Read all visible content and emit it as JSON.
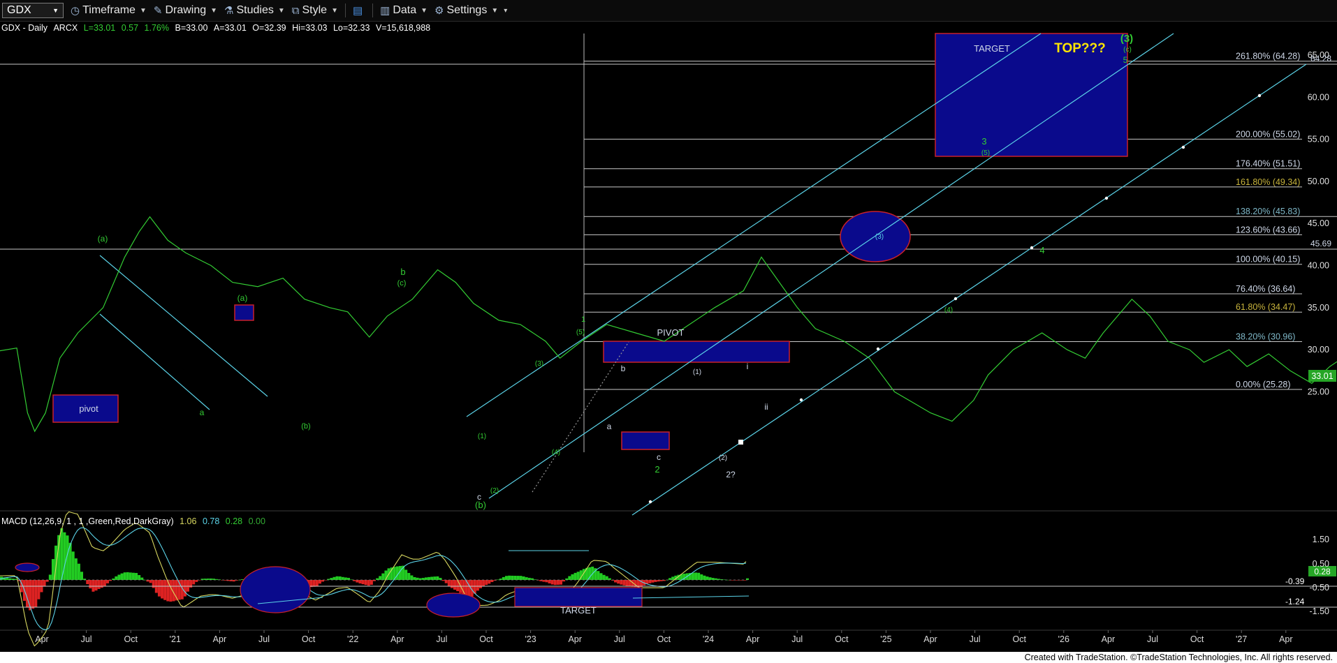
{
  "toolbar": {
    "symbol": "GDX",
    "timeframe_label": "Timeframe",
    "drawing_label": "Drawing",
    "studies_label": "Studies",
    "style_label": "Style",
    "data_label": "Data",
    "settings_label": "Settings"
  },
  "header": {
    "title": "GDX - Daily",
    "exchange": "ARCX",
    "last": "L=33.01",
    "change": "0.57",
    "change_pct": "1.76%",
    "bid": "B=33.00",
    "ask": "A=33.01",
    "open": "O=32.39",
    "high": "Hi=33.03",
    "low": "Lo=32.33",
    "volume": "V=15,618,988"
  },
  "macd": {
    "title": "MACD (12,26,9, 1 , 1 ,Green,Red,DarkGray)",
    "v1": "1.06",
    "v2": "0.78",
    "v3": "0.28",
    "v4": "0.00",
    "y_ticks": [
      "1.50",
      "0.50",
      "-0.50",
      "-1.50"
    ],
    "markers": [
      "-0.39",
      "-1.24"
    ],
    "current": "0.28"
  },
  "footer": {
    "text": "Created with TradeStation. ©TradeStation Technologies, Inc. All rights reserved."
  },
  "colors": {
    "price": "#33cc33",
    "fib_line": "#c8c8c8",
    "channel": "#5bd3e8",
    "box_fill": "#0a0a8c",
    "box_border": "#c8202a",
    "label_green": "#33cc33",
    "label_cyan": "#5bd3e8",
    "fib_label_default": "#cfd8e8",
    "fib_label_gold": "#c8b43c",
    "fib_label_teal": "#7fb8c8",
    "top_text": "#ffe600",
    "price_tag": "#26a626"
  },
  "chart_data": {
    "type": "line",
    "symbol": "GDX",
    "interval": "Daily",
    "y_axis": {
      "min": 20,
      "max": 67,
      "ticks": [
        25,
        30,
        35,
        40,
        45,
        50,
        55,
        60,
        65
      ]
    },
    "x_axis_labels": [
      "Apr",
      "Jul",
      "Oct",
      "'21",
      "Apr",
      "Jul",
      "Oct",
      "'22",
      "Apr",
      "Jul",
      "Oct",
      "'23",
      "Apr",
      "Jul",
      "Oct",
      "'24",
      "Apr",
      "Jul",
      "Oct",
      "'25",
      "Apr",
      "Jul",
      "Oct",
      "'26",
      "Apr",
      "Jul",
      "Oct",
      "'27",
      "Apr"
    ],
    "last_price": "33.01",
    "price_points": [
      [
        2020.0,
        29
      ],
      [
        2020.08,
        29.5
      ],
      [
        2020.18,
        30.2
      ],
      [
        2020.21,
        22.5
      ],
      [
        2020.23,
        20.3
      ],
      [
        2020.26,
        22.5
      ],
      [
        2020.3,
        29
      ],
      [
        2020.35,
        32
      ],
      [
        2020.42,
        35
      ],
      [
        2020.48,
        41
      ],
      [
        2020.52,
        44
      ],
      [
        2020.55,
        45.8
      ],
      [
        2020.6,
        43
      ],
      [
        2020.65,
        41.5
      ],
      [
        2020.72,
        40
      ],
      [
        2020.78,
        38
      ],
      [
        2020.85,
        37.5
      ],
      [
        2020.92,
        38.5
      ],
      [
        2020.98,
        36
      ],
      [
        2021.05,
        35
      ],
      [
        2021.1,
        34.5
      ],
      [
        2021.16,
        31.5
      ],
      [
        2021.21,
        34
      ],
      [
        2021.28,
        36
      ],
      [
        2021.35,
        39.5
      ],
      [
        2021.4,
        38
      ],
      [
        2021.45,
        35.5
      ],
      [
        2021.52,
        33.5
      ],
      [
        2021.58,
        33
      ],
      [
        2021.65,
        31
      ],
      [
        2021.69,
        29
      ],
      [
        2021.75,
        31
      ],
      [
        2021.82,
        33
      ],
      [
        2021.9,
        32
      ],
      [
        2021.98,
        31
      ],
      [
        2022.05,
        33
      ],
      [
        2022.12,
        35
      ],
      [
        2022.2,
        37
      ],
      [
        2022.25,
        41
      ],
      [
        2022.3,
        38
      ],
      [
        2022.35,
        35
      ],
      [
        2022.4,
        32.5
      ],
      [
        2022.48,
        31
      ],
      [
        2022.55,
        29
      ],
      [
        2022.62,
        25
      ],
      [
        2022.68,
        23.5
      ],
      [
        2022.72,
        22.5
      ],
      [
        2022.78,
        21.5
      ],
      [
        2022.84,
        24
      ],
      [
        2022.88,
        27
      ],
      [
        2022.95,
        30
      ],
      [
        2023.03,
        32
      ],
      [
        2023.1,
        30
      ],
      [
        2023.15,
        29
      ],
      [
        2023.2,
        32
      ],
      [
        2023.28,
        36
      ],
      [
        2023.33,
        34
      ],
      [
        2023.38,
        31
      ],
      [
        2023.44,
        30
      ],
      [
        2023.48,
        28.5
      ],
      [
        2023.55,
        30
      ],
      [
        2023.6,
        28
      ],
      [
        2023.66,
        29.5
      ],
      [
        2023.72,
        27.5
      ],
      [
        2023.78,
        26
      ],
      [
        2023.83,
        28
      ],
      [
        2023.9,
        30
      ],
      [
        2023.97,
        32
      ],
      [
        2024.02,
        30
      ],
      [
        2024.06,
        28
      ],
      [
        2024.1,
        26
      ],
      [
        2024.15,
        25.6
      ],
      [
        2024.18,
        27.5
      ],
      [
        2024.22,
        29.5
      ],
      [
        2024.25,
        31
      ],
      [
        2024.27,
        33.01
      ]
    ],
    "fib_levels": [
      {
        "label": "261.80% (64.28)",
        "value": 64.28,
        "color": "#cfd8e8"
      },
      {
        "label": "200.00% (55.02)",
        "value": 55.02,
        "color": "#cfd8e8"
      },
      {
        "label": "176.40% (51.51)",
        "value": 51.51,
        "color": "#cfd8e8"
      },
      {
        "label": "161.80% (49.34)",
        "value": 49.34,
        "color": "#c8b43c"
      },
      {
        "label": "138.20% (45.83)",
        "value": 45.83,
        "color": "#7fb8c8"
      },
      {
        "label": "123.60% (43.66)",
        "value": 43.66,
        "color": "#cfd8e8"
      },
      {
        "label": "100.00% (40.15)",
        "value": 40.15,
        "color": "#cfd8e8"
      },
      {
        "label": "76.40% (36.64)",
        "value": 36.64,
        "color": "#cfd8e8"
      },
      {
        "label": "61.80% (34.47)",
        "value": 34.47,
        "color": "#c8b43c"
      },
      {
        "label": "38.20% (30.96)",
        "value": 30.96,
        "color": "#7fb8c8"
      },
      {
        "label": "0.00% (25.28)",
        "value": 25.28,
        "color": "#cfd8e8"
      }
    ],
    "horizontal_lines": [
      64.28,
      45.83
    ],
    "annotations": {
      "target": "TARGET",
      "top": "TOP???",
      "pivot_box": "PIVOT",
      "pivot_label": "pivot",
      "macd_target": "TARGET",
      "tags": [
        "64.28",
        "45.69"
      ]
    },
    "wave_labels": [
      "(a)",
      "a",
      "(a)",
      "(b)",
      "b",
      "(c)",
      "c",
      "(b)",
      "(1)",
      "(2)",
      "(3)",
      "(4)",
      "(5)",
      "1",
      "a",
      "b",
      "c",
      "2",
      "(1)",
      "(2)",
      "2?",
      "i",
      "ii",
      "(3)",
      "3",
      "(5)",
      "(4)",
      "4",
      "5",
      "(c)",
      "(3)"
    ]
  }
}
